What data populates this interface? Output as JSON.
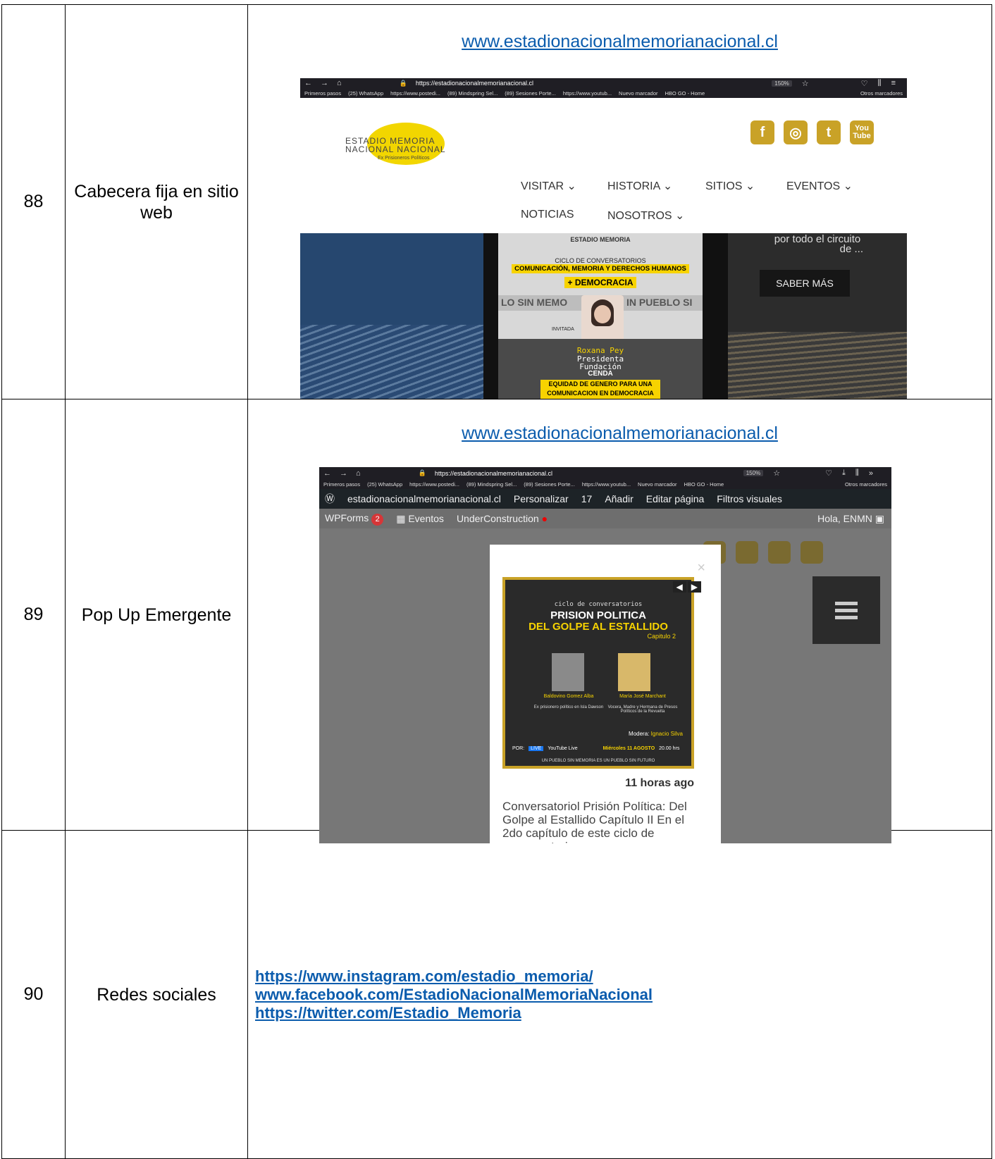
{
  "rows": [
    {
      "num": "88",
      "desc": "Cabecera fija en sitio web",
      "url": "www.estadionacionalmemorianacional.cl",
      "shot": {
        "address": "https://estadionacionalmemorianacional.cl",
        "zoom": "150%",
        "bookmarks": [
          "Primeros pasos",
          "(25) WhatsApp",
          "https://www.postedi...",
          "(89) Mindspring Sel...",
          "(89) Sesiones Porte...",
          "https://www.youtub...",
          "Nuevo marcador",
          "HBO GO - Home"
        ],
        "other_bookmarks": "Otros marcadores",
        "logo": {
          "line1": "ESTADIO MEMORIA",
          "line2": "NACIONAL NACIONAL",
          "sub": "Ex Prisioneros Políticos"
        },
        "social": [
          "f",
          "◎",
          "t",
          "You Tube"
        ],
        "nav": [
          "VISITAR ⌄",
          "HISTORIA ⌄",
          "SITIOS ⌄",
          "EVENTOS ⌄",
          "NOTICIAS",
          "NOSOTROS ⌄"
        ],
        "right_panel": {
          "text1": "por todo el circuito",
          "text2": "de ...",
          "button": "SABER MÁS"
        },
        "poster": {
          "line1": "CICLO DE CONVERSATORIOS",
          "line2": "COMUNICACIÓN, MEMORIA Y DERECHOS HUMANOS",
          "line3": "+ DEMOCRACIA",
          "wall": "LO SIN MEMO",
          "wall2": "IN PUEBLO SI",
          "invitada": "INVITADA",
          "name": "Roxana Pey",
          "role1": "Presidenta",
          "role2": "Fundación",
          "org": "CENDA",
          "footer1": "EQUIDAD DE GENERO PARA UNA",
          "footer2": "COMUNICACION EN DEMOCRACIA"
        }
      }
    },
    {
      "num": "89",
      "desc": "Pop Up Emergente",
      "url": "www.estadionacionalmemorianacional.cl",
      "shot": {
        "address": "https://estadionacionalmemorianacional.cl",
        "zoom": "150%",
        "bookmarks": [
          "Primeros pasos",
          "(25) WhatsApp",
          "https://www.postedi...",
          "(89) Mindspring Sel...",
          "(89) Sesiones Porte...",
          "https://www.youtub...",
          "Nuevo marcador",
          "HBO GO - Home"
        ],
        "other_bookmarks": "Otros marcadores",
        "wp": [
          "estadionacionalmemorianacional.cl",
          "Personalizar",
          "17",
          "Añadir",
          "Editar página",
          "Filtros visuales"
        ],
        "wp2": {
          "wpforms": "WPForms",
          "wpforms_count": "2",
          "eventos": "Eventos",
          "under": "UnderConstruction",
          "hola": "Hola, ENMN"
        },
        "popup": {
          "title_small": "ciclo de conversatorios",
          "title1": "PRISION POLITICA",
          "title2": "DEL GOLPE AL ESTALLIDO",
          "chapter": "Capitulo 2",
          "guest1": "Baldovino Gomez Alba",
          "guest1_role": "Ex prisionero político en Isla Dawson",
          "guest2": "María José Marchant",
          "guest2_role": "Vocera, Madre y Hermana de Presos Políticos de la Revuelta",
          "modera": "Modera:",
          "moderator": "Ignacio Silva",
          "por": "POR:",
          "live": "LIVE",
          "youtube_live": "YouTube Live",
          "date": "Miércoles 11 AGOSTO",
          "time": "20.00 hrs",
          "slogan": "UN PUEBLO SIN MEMORIA ES UN PUEBLO SIN FUTURO",
          "ago": "11 horas ago",
          "body": "Conversatoriol Prisión Política: Del Golpe al Estallido Capítulo II En el 2do capítulo de este ciclo de conversatorios acerca"
        }
      }
    },
    {
      "num": "90",
      "desc": "Redes sociales",
      "links": [
        "https://www.instagram.com/estadio_memoria/",
        "www.facebook.com/EstadioNacionalMemoriaNacional",
        "https://twitter.com/Estadio_Memoria"
      ]
    }
  ]
}
